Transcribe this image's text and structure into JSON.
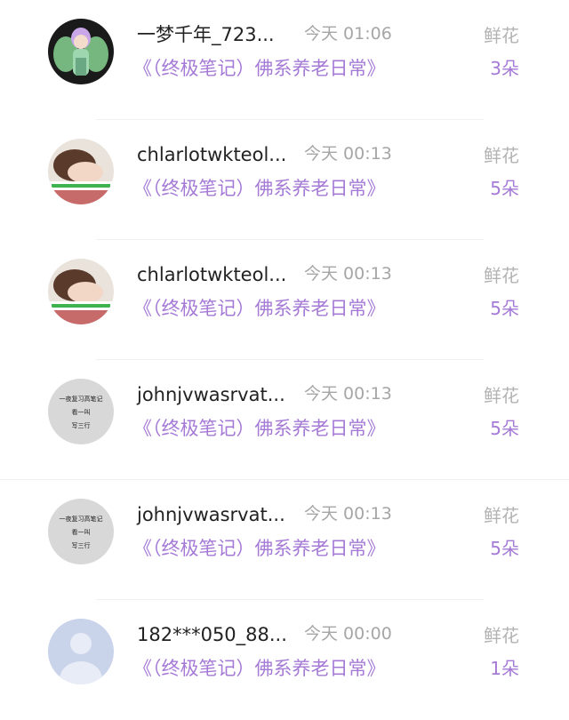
{
  "records": [
    {
      "user_name": "一梦千年_723...",
      "time": "今天 01:06",
      "gift_label": "鲜花",
      "book_title": "《（终极笔记）佛系养老日常》",
      "gift_count": "3朵",
      "avatar_icon": "anime-girl-avatar-icon"
    },
    {
      "user_name": "chlarlotwkteol...",
      "time": "今天 00:13",
      "gift_label": "鲜花",
      "book_title": "《（终极笔记）佛系养老日常》",
      "gift_count": "5朵",
      "avatar_icon": "sleeping-girl-avatar-icon"
    },
    {
      "user_name": "chlarlotwkteol...",
      "time": "今天 00:13",
      "gift_label": "鲜花",
      "book_title": "《（终极笔记）佛系养老日常》",
      "gift_count": "5朵",
      "avatar_icon": "sleeping-girl-avatar-icon"
    },
    {
      "user_name": "johnjvwasrvat...",
      "time": "今天 00:13",
      "gift_label": "鲜花",
      "book_title": "《（终极笔记）佛系养老日常》",
      "gift_count": "5朵",
      "avatar_icon": "text-avatar-icon",
      "avatar_text": [
        "一夜复习高笔记",
        "看一叫",
        "写三行"
      ]
    },
    {
      "user_name": "johnjvwasrvat...",
      "time": "今天 00:13",
      "gift_label": "鲜花",
      "book_title": "《（终极笔记）佛系养老日常》",
      "gift_count": "5朵",
      "avatar_icon": "text-avatar-icon",
      "avatar_text": [
        "一夜复习高笔记",
        "看一叫",
        "写三行"
      ]
    },
    {
      "user_name": "182***050_88...",
      "time": "今天 00:00",
      "gift_label": "鲜花",
      "book_title": "《（终极笔记）佛系养老日常》",
      "gift_count": "1朵",
      "avatar_icon": "default-user-avatar-icon"
    }
  ],
  "colors": {
    "accent_purple": "#a57ad6",
    "username_text": "#222222",
    "muted_text": "#a6a6a6"
  }
}
